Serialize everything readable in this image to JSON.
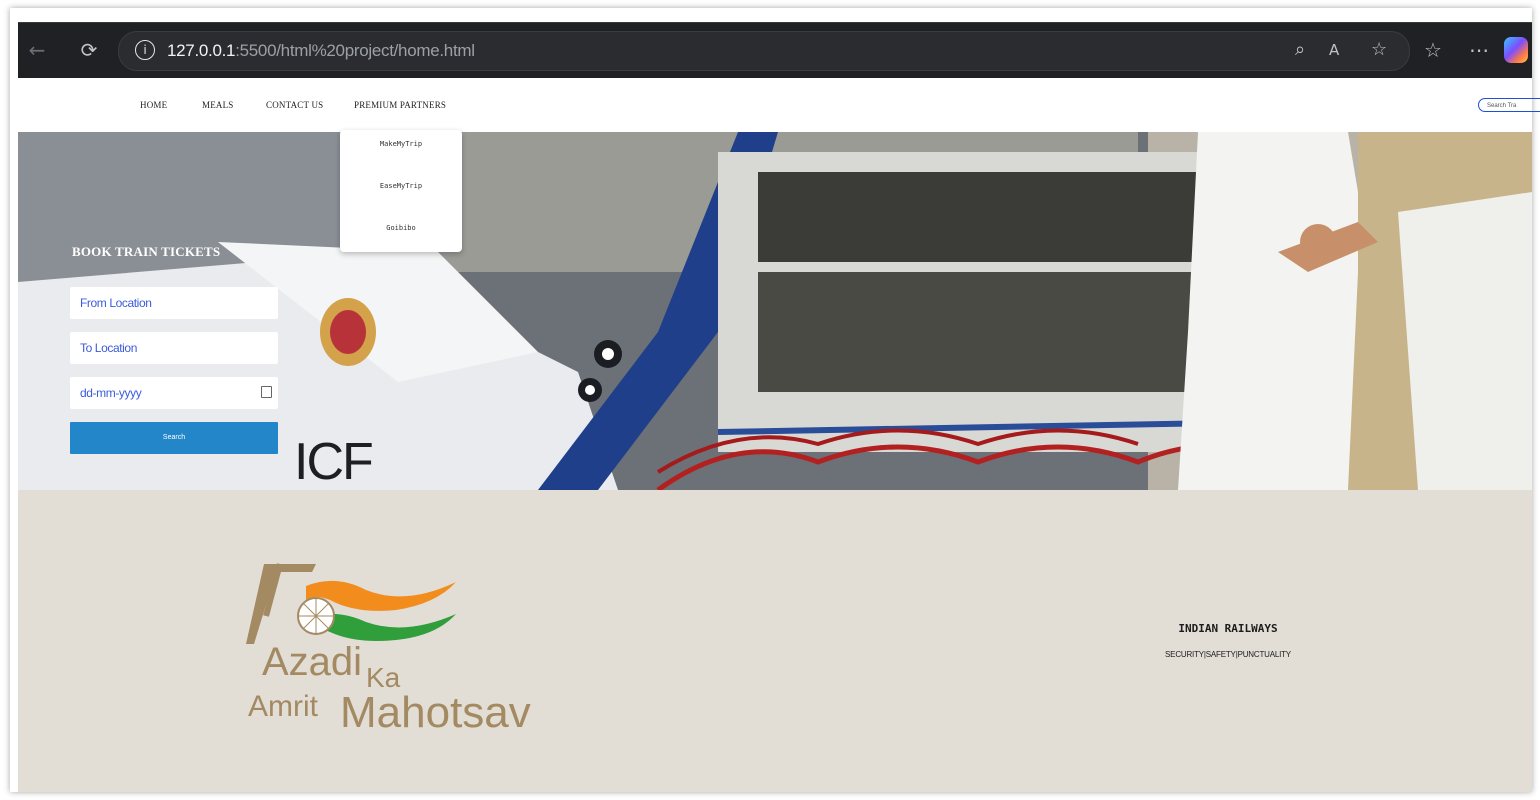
{
  "browser": {
    "url_host": "127.0.0.1",
    "url_rest": ":5500/html%20project/home.html",
    "back_icon": "arrow-left-icon",
    "reload_icon": "reload-icon",
    "info_icon": "info-icon",
    "zoom_icon": "zoom-icon",
    "read_aloud_icon": "read-aloud-icon",
    "favorite_icon": "star-icon",
    "favorites_icon": "favorites-list-icon",
    "more_icon": "more-icon",
    "copilot_icon": "copilot-icon"
  },
  "nav": {
    "items": [
      "HOME",
      "MEALS",
      "CONTACT US",
      "PREMIUM PARTNERS"
    ],
    "search_placeholder": "Search Tra"
  },
  "dropdown": {
    "items": [
      "MakeMyTrip",
      "EaseMyTrip",
      "Goibibo"
    ]
  },
  "booking": {
    "title": "BOOK TRAIN TICKETS",
    "from_placeholder": "From Location",
    "to_placeholder": "To Location",
    "date_placeholder": "dd-mm-yyyy",
    "search_label": "Search"
  },
  "hero": {
    "train_mark": "ICF"
  },
  "footer": {
    "logo_number": "75",
    "logo_line1": "Azadi",
    "logo_ka": "Ka",
    "logo_line2a": "Amrit",
    "logo_line2b": "Mahotsav",
    "org_title": "INDIAN RAILWAYS",
    "tagline": "SECURITY|SAFETY|PUNCTUALITY"
  },
  "colors": {
    "accent_blue": "#2386c8",
    "footer_bg": "#e2ded6",
    "logo_gold": "#a38a62",
    "saffron": "#f28c1c",
    "green": "#2f9e3b"
  }
}
